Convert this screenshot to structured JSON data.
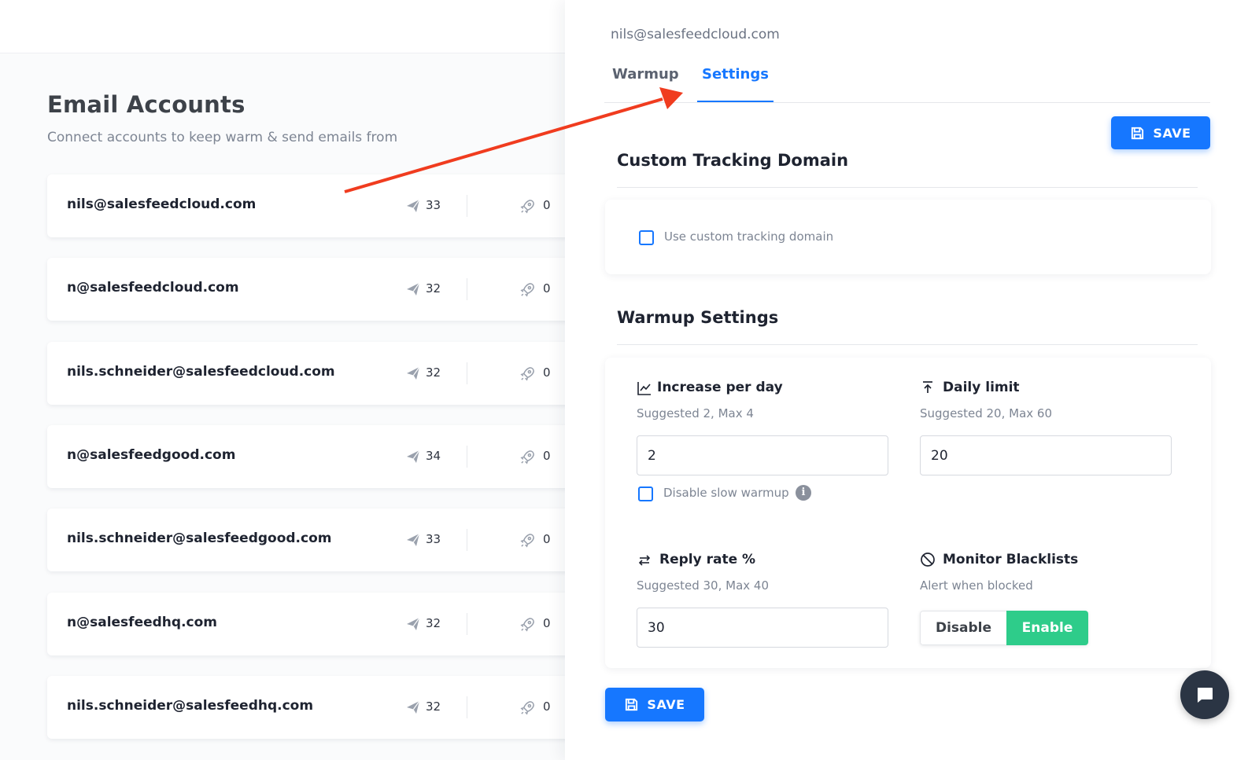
{
  "page": {
    "title": "Email Accounts",
    "subtitle": "Connect accounts to keep warm & send emails from"
  },
  "accounts": [
    {
      "email": "nils@salesfeedcloud.com",
      "sent": "33",
      "warmup": "0"
    },
    {
      "email": "n@salesfeedcloud.com",
      "sent": "32",
      "warmup": "0"
    },
    {
      "email": "nils.schneider@salesfeedcloud.com",
      "sent": "32",
      "warmup": "0"
    },
    {
      "email": "n@salesfeedgood.com",
      "sent": "34",
      "warmup": "0"
    },
    {
      "email": "nils.schneider@salesfeedgood.com",
      "sent": "33",
      "warmup": "0"
    },
    {
      "email": "n@salesfeedhq.com",
      "sent": "32",
      "warmup": "0"
    },
    {
      "email": "nils.schneider@salesfeedhq.com",
      "sent": "32",
      "warmup": "0"
    }
  ],
  "drawer": {
    "email": "nils@salesfeedcloud.com",
    "tabs": [
      {
        "label": "Warmup",
        "active": false
      },
      {
        "label": "Settings",
        "active": true
      }
    ],
    "save_label": "SAVE",
    "tracking": {
      "title": "Custom Tracking Domain",
      "checkbox_label": "Use custom tracking domain",
      "checked": false
    },
    "warmup": {
      "title": "Warmup Settings",
      "increase": {
        "label": "Increase per day",
        "hint": "Suggested 2, Max 4",
        "value": "2"
      },
      "slow_warmup": {
        "label": "Disable slow warmup",
        "checked": false
      },
      "daily_limit": {
        "label": "Daily limit",
        "hint": "Suggested 20, Max 60",
        "value": "20"
      },
      "reply_rate": {
        "label": "Reply rate %",
        "hint": "Suggested 30, Max 40",
        "value": "30"
      },
      "blacklists": {
        "label": "Monitor Blacklists",
        "hint": "Alert when blocked",
        "disable_label": "Disable",
        "enable_label": "Enable",
        "selected": "Enable"
      }
    }
  },
  "colors": {
    "accent": "#1677ff",
    "enable": "#2ecc8a",
    "arrow": "#f03c1f"
  }
}
